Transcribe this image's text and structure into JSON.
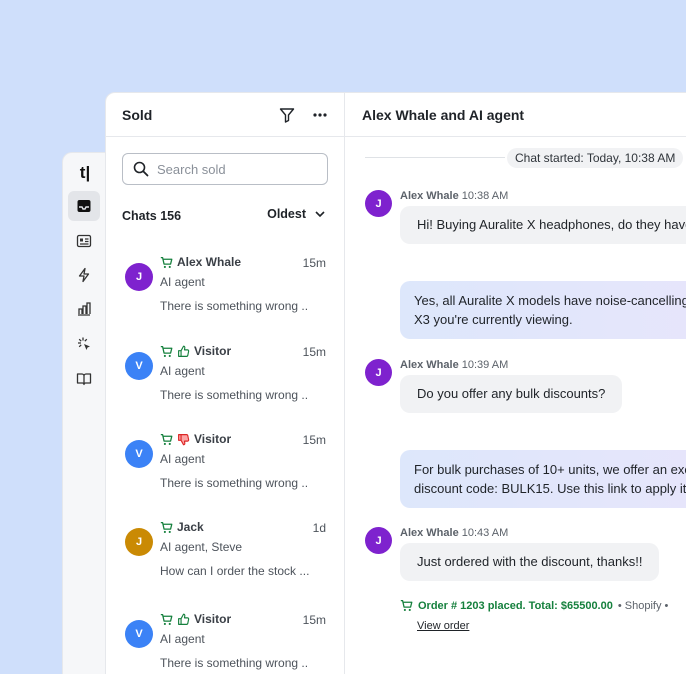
{
  "rail": {
    "logo": "t|",
    "items": [
      "inbox-icon",
      "contact-card-icon",
      "bolt-icon",
      "chart-icon",
      "sparkle-cursor-icon",
      "book-icon"
    ]
  },
  "list": {
    "title": "Sold",
    "search_placeholder": "Search sold",
    "chats_label": "Chats 156",
    "sort_label": "Oldest",
    "items": [
      {
        "initial": "J",
        "name": "Alex Whale",
        "time": "15m",
        "sub": "AI agent",
        "preview": "There is something wrong ..",
        "avatar_color": "#7e22ce",
        "rating": "none"
      },
      {
        "initial": "V",
        "name": "Visitor",
        "time": "15m",
        "sub": "AI agent",
        "preview": "There is something wrong ..",
        "avatar_color": "#3b82f6",
        "rating": "thumbs-up"
      },
      {
        "initial": "V",
        "name": "Visitor",
        "time": "15m",
        "sub": "AI agent",
        "preview": "There is something wrong ..",
        "avatar_color": "#3b82f6",
        "rating": "thumbs-down"
      },
      {
        "initial": "J",
        "name": "Jack",
        "time": "1d",
        "sub": "AI agent, Steve",
        "preview": "How can I order the stock ...",
        "avatar_color": "#ca8a04",
        "rating": "none"
      },
      {
        "initial": "V",
        "name": "Visitor",
        "time": "15m",
        "sub": "AI agent",
        "preview": "There is something wrong ..",
        "avatar_color": "#3b82f6",
        "rating": "thumbs-up"
      }
    ]
  },
  "conversation": {
    "title": "Alex Whale and AI agent",
    "started": "Chat started: Today, 10:38 AM",
    "messages": [
      {
        "author": "Alex Whale",
        "time": "10:38 AM",
        "initial": "J",
        "text": "Hi! Buying Auralite X  headphones, do they have"
      },
      {
        "line1": "Yes, all Auralite X models have noise-cancelling,",
        "line2": "X3 you're currently viewing."
      },
      {
        "author": "Alex Whale",
        "time": "10:39 AM",
        "initial": "J",
        "text": "Do you offer any bulk discounts?"
      },
      {
        "line1": "For bulk purchases of 10+ units, we offer an excl",
        "line2": "discount code: BULK15. Use this link to apply it t"
      },
      {
        "author": "Alex Whale",
        "time": "10:43 AM",
        "initial": "J",
        "text": "Just ordered with the discount, thanks!!"
      }
    ],
    "order": {
      "text": "Order # 1203 placed. Total: $65500.00",
      "source": "• Shopify •",
      "link": "View order"
    }
  },
  "colors": {
    "background": "#cfdffb",
    "accent_green": "#15803d",
    "thumbs_down_red": "#dc2626"
  }
}
